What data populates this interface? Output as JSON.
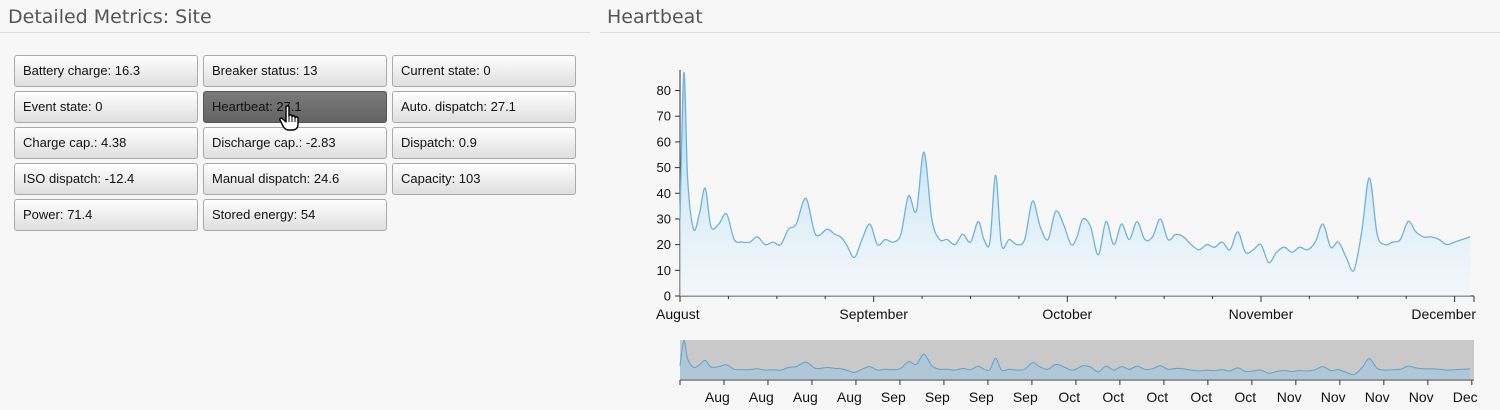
{
  "left_title": "Detailed Metrics: Site",
  "right_title": "Heartbeat",
  "metrics": [
    {
      "label": "Battery charge: 16.3",
      "active": false
    },
    {
      "label": "Breaker status: 13",
      "active": false
    },
    {
      "label": "Current state: 0",
      "active": false
    },
    {
      "label": "Event state: 0",
      "active": false
    },
    {
      "label": "Heartbeat: 27.1",
      "active": true
    },
    {
      "label": "Auto. dispatch: 27.1",
      "active": false
    },
    {
      "label": "Charge cap.: 4.38",
      "active": false
    },
    {
      "label": "Discharge cap.: -2.83",
      "active": false
    },
    {
      "label": "Dispatch: 0.9",
      "active": false
    },
    {
      "label": "ISO dispatch: -12.4",
      "active": false
    },
    {
      "label": "Manual dispatch: 24.6",
      "active": false
    },
    {
      "label": "Capacity: 103",
      "active": false
    },
    {
      "label": "Power: 71.4",
      "active": false
    },
    {
      "label": "Stored energy: 54",
      "active": false
    }
  ],
  "colors": {
    "line": "#6fb3dc",
    "fill_top": "#9fd0f0",
    "fill_bottom": "#eef7fd",
    "nav_bg": "#c9c9c9",
    "active_button": "#6e6e6e"
  },
  "chart_data": {
    "type": "area",
    "title": "Heartbeat",
    "ylim": [
      0,
      88
    ],
    "yticks": [
      0,
      10,
      20,
      30,
      40,
      50,
      60,
      70,
      80
    ],
    "xlim": [
      0,
      4.1
    ],
    "xticks": [
      {
        "pos": 0,
        "label": "August"
      },
      {
        "pos": 1,
        "label": "September"
      },
      {
        "pos": 2,
        "label": "October"
      },
      {
        "pos": 3,
        "label": "November"
      },
      {
        "pos": 4,
        "label": "December"
      }
    ],
    "x": [
      0,
      0.02,
      0.04,
      0.07,
      0.1,
      0.13,
      0.16,
      0.2,
      0.24,
      0.28,
      0.32,
      0.36,
      0.4,
      0.44,
      0.48,
      0.52,
      0.56,
      0.6,
      0.65,
      0.7,
      0.76,
      0.8,
      0.83,
      0.86,
      0.9,
      0.94,
      0.98,
      1.02,
      1.06,
      1.1,
      1.14,
      1.18,
      1.22,
      1.26,
      1.3,
      1.34,
      1.38,
      1.42,
      1.46,
      1.5,
      1.54,
      1.57,
      1.6,
      1.63,
      1.66,
      1.7,
      1.74,
      1.78,
      1.82,
      1.86,
      1.9,
      1.94,
      1.98,
      2.02,
      2.05,
      2.08,
      2.12,
      2.16,
      2.2,
      2.24,
      2.28,
      2.32,
      2.36,
      2.4,
      2.44,
      2.48,
      2.52,
      2.56,
      2.6,
      2.64,
      2.68,
      2.72,
      2.76,
      2.8,
      2.84,
      2.88,
      2.92,
      2.96,
      3.0,
      3.04,
      3.08,
      3.12,
      3.16,
      3.2,
      3.24,
      3.28,
      3.32,
      3.36,
      3.4,
      3.44,
      3.48,
      3.52,
      3.56,
      3.6,
      3.64,
      3.68,
      3.72,
      3.76,
      3.8,
      3.84,
      3.88,
      3.92,
      3.96,
      4.0,
      4.04,
      4.08
    ],
    "y": [
      30,
      87,
      45,
      26,
      32,
      42,
      27,
      28,
      32,
      22,
      21,
      21,
      23,
      20,
      21,
      20,
      26,
      28,
      38,
      24,
      26,
      24,
      23,
      20,
      15,
      22,
      28,
      20,
      22,
      21,
      24,
      39,
      33,
      56,
      30,
      22,
      22,
      20,
      24,
      21,
      29,
      22,
      21,
      47,
      20,
      22,
      20,
      22,
      37,
      27,
      22,
      33,
      28,
      20,
      23,
      30,
      27,
      16,
      29,
      20,
      28,
      22,
      29,
      22,
      23,
      30,
      22,
      24,
      23,
      20,
      18,
      20,
      19,
      21,
      18,
      25,
      17,
      18,
      20,
      13,
      17,
      19,
      17,
      19,
      18,
      21,
      28,
      19,
      21,
      15,
      10,
      25,
      46,
      24,
      20,
      21,
      22,
      29,
      25,
      23,
      23,
      22,
      20,
      21,
      22,
      23
    ],
    "navigator": {
      "tick_labels": [
        "Aug",
        "Aug",
        "Aug",
        "Aug",
        "Sep",
        "Sep",
        "Sep",
        "Sep",
        "Oct",
        "Oct",
        "Oct",
        "Oct",
        "Oct",
        "Nov",
        "Nov",
        "Nov",
        "Nov",
        "Dec"
      ]
    }
  }
}
